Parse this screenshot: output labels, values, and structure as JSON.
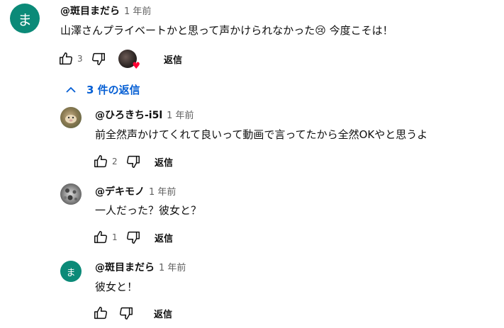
{
  "main_comment": {
    "avatar_letter": "ま",
    "author": "@斑目まだら",
    "time": "1 年前",
    "text": "山澤さんプライベートかと思って声かけられなかった😢 今度こそは！",
    "like_count": "3",
    "reply_label": "返信"
  },
  "replies_toggle": {
    "label": "3 件の返信"
  },
  "replies": [
    {
      "author": "@ひろきち-i5l",
      "time": "1 年前",
      "text": "前全然声かけてくれて良いって動画で言ってたから全然OKやと思うよ",
      "like_count": "2",
      "reply_label": "返信"
    },
    {
      "author": "@デキモノ",
      "time": "1 年前",
      "text": "一人だった？彼女と？",
      "like_count": "1",
      "reply_label": "返信"
    },
    {
      "avatar_letter": "ま",
      "author": "@斑目まだら",
      "time": "1 年前",
      "text": "彼女と！",
      "like_count": "",
      "reply_label": "返信"
    }
  ],
  "colors": {
    "avatar_teal": "#0b8a78",
    "link_blue": "#065fd4",
    "meta_gray": "#606060"
  }
}
